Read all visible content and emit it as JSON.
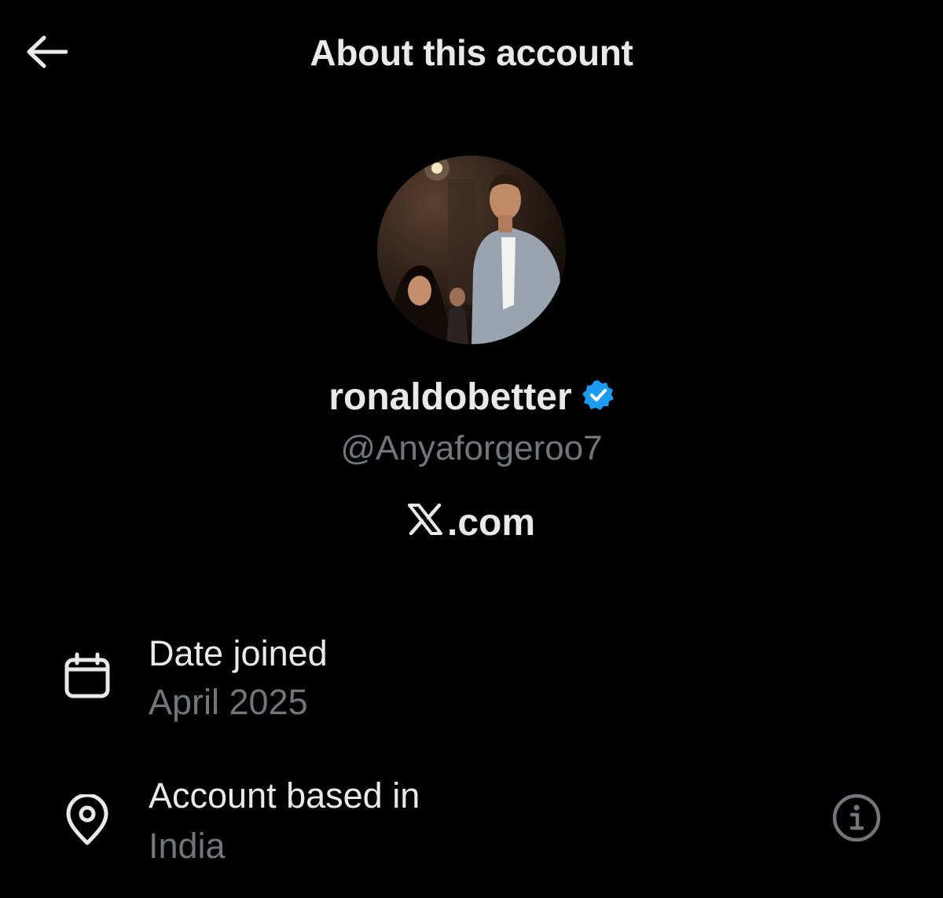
{
  "header": {
    "title": "About this account",
    "back_icon": "arrow-left-icon"
  },
  "profile": {
    "display_name": "ronaldobetter",
    "verified_icon": "verified-badge-icon",
    "verified_color": "#1d9bf0",
    "handle": "@Anyaforgeroo7",
    "site_logo": "x-logo-icon",
    "site_suffix": ".com"
  },
  "details": {
    "date_joined": {
      "icon": "calendar-icon",
      "label": "Date joined",
      "value": "April 2025"
    },
    "account_based_in": {
      "icon": "location-pin-icon",
      "label": "Account based in",
      "value": "India",
      "info_icon": "info-icon"
    }
  },
  "colors": {
    "background": "#000000",
    "primary_text": "#e7e9ea",
    "secondary_text": "#71767b"
  }
}
